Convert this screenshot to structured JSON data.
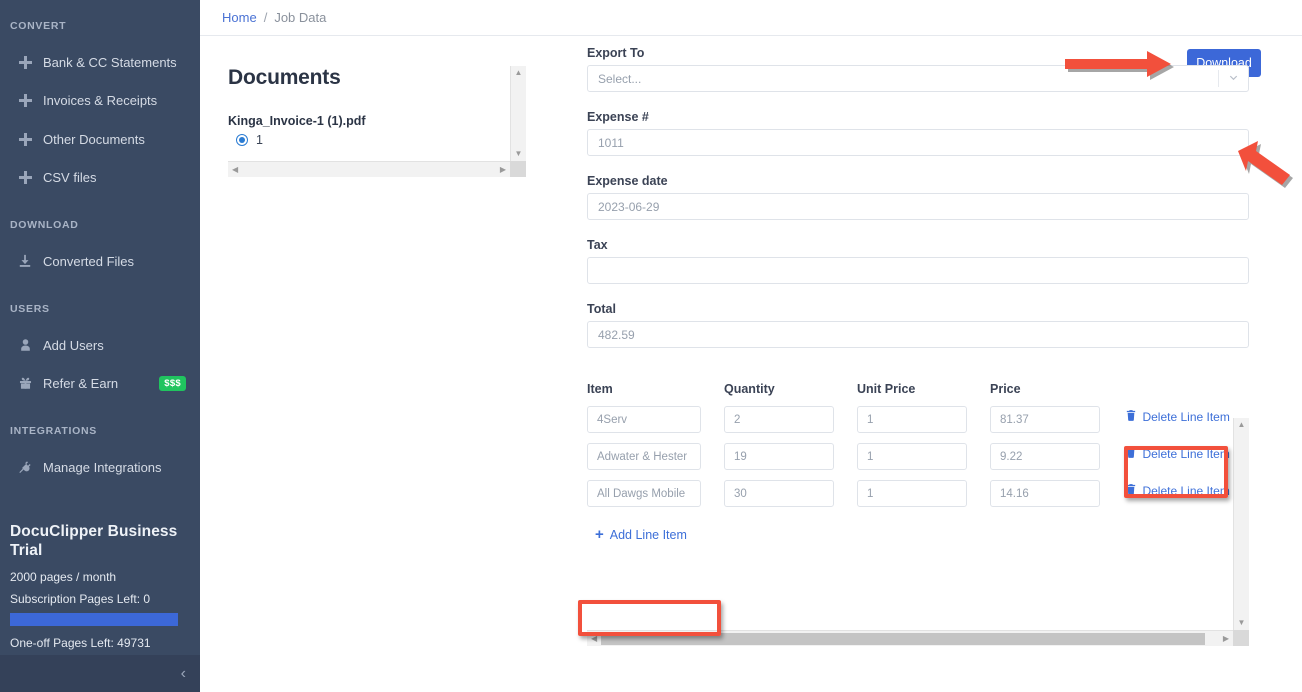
{
  "sidebar": {
    "sections": [
      {
        "label": "CONVERT"
      },
      {
        "label": "DOWNLOAD"
      },
      {
        "label": "USERS"
      },
      {
        "label": "INTEGRATIONS"
      }
    ],
    "items": [
      {
        "label": "Bank & CC Statements",
        "icon": "plus-icon"
      },
      {
        "label": "Invoices & Receipts",
        "icon": "plus-icon"
      },
      {
        "label": "Other Documents",
        "icon": "plus-icon"
      },
      {
        "label": "CSV files",
        "icon": "plus-icon"
      },
      {
        "label": "Converted Files",
        "icon": "download-icon"
      },
      {
        "label": "Add Users",
        "icon": "user-icon"
      },
      {
        "label": "Refer & Earn",
        "icon": "gift-icon",
        "badge": "$$$"
      },
      {
        "label": "Manage Integrations",
        "icon": "plug-icon"
      }
    ],
    "plan": {
      "title": "DocuClipper Business Trial",
      "pages_per_month": "2000 pages / month",
      "subscription_pages_left": "Subscription Pages Left: 0",
      "progress_percent": 100,
      "one_off_pages_left": "One-off Pages Left: 49731",
      "progress_color": "#3c68d8"
    },
    "collapse_icon": "chevron-left-icon"
  },
  "breadcrumb": {
    "home": "Home",
    "separator": "/",
    "current": "Job Data"
  },
  "documents": {
    "title": "Documents",
    "file_name": "Kinga_Invoice-1 (1).pdf",
    "page_number": "1"
  },
  "toolbar": {
    "download_label": "Download",
    "download_color": "#3c68d8"
  },
  "form": {
    "export_to": {
      "label": "Export To",
      "value": "",
      "placeholder": "Select..."
    },
    "expense_number": {
      "label": "Expense #",
      "value": "1011"
    },
    "expense_date": {
      "label": "Expense date",
      "value": "2023-06-29"
    },
    "tax": {
      "label": "Tax",
      "value": ""
    },
    "total": {
      "label": "Total",
      "value": "482.59"
    }
  },
  "line_items": {
    "columns": [
      "Item",
      "Quantity",
      "Unit Price",
      "Price"
    ],
    "rows": [
      {
        "item": "4Serv",
        "quantity": "2",
        "unit_price": "1",
        "price": "81.37",
        "delete_label": "Delete Line Item"
      },
      {
        "item": "Adwater & Hester",
        "quantity": "19",
        "unit_price": "1",
        "price": "9.22",
        "delete_label": "Delete Line Item"
      },
      {
        "item": "All Dawgs Mobile",
        "quantity": "30",
        "unit_price": "1",
        "price": "14.16",
        "delete_label": "Delete Line Item"
      }
    ],
    "add_label": "Add Line Item",
    "delete_icon": "trash-icon",
    "add_icon": "plus-icon"
  },
  "annotations": {
    "highlight_color": "#f2503c",
    "arrow_download": "arrow-pointing-right-to-download-button",
    "arrow_select": "arrow-pointing-up-left-to-export-dropdown",
    "box_delete_line_item": "highlight-first-delete-line-item",
    "box_add_line_item": "highlight-add-line-item"
  }
}
